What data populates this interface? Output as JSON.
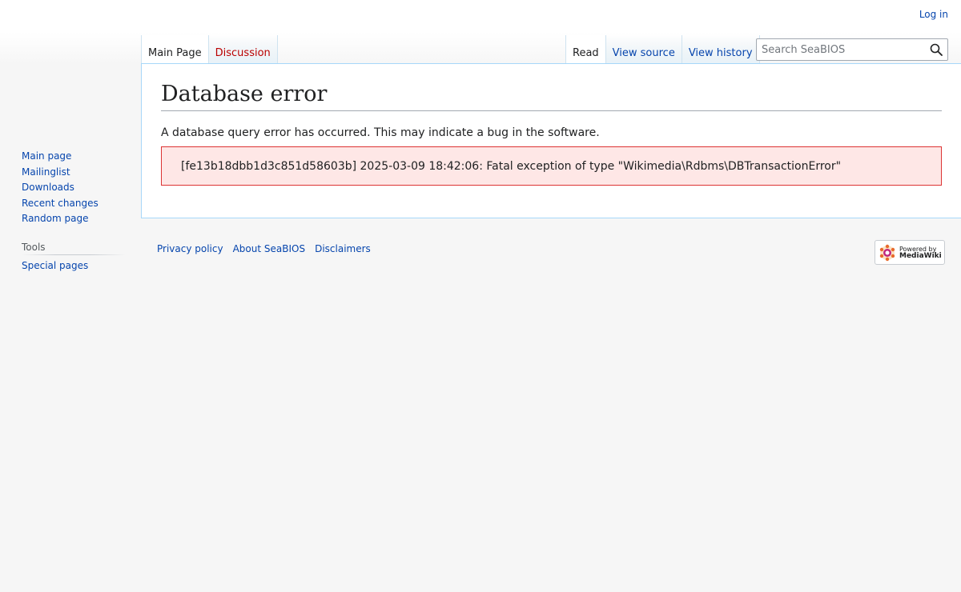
{
  "personal": {
    "login": "Log in"
  },
  "tabs": {
    "left": [
      "Main Page",
      "Discussion"
    ],
    "right": [
      "Read",
      "View source",
      "View history"
    ]
  },
  "search": {
    "placeholder": "Search SeaBIOS"
  },
  "content": {
    "title": "Database error",
    "intro": "A database query error has occurred. This may indicate a bug in the software.",
    "error": "[fe13b18dbb1d3c851d58603b] 2025-03-09 18:42:06: Fatal exception of type \"Wikimedia\\Rdbms\\DBTransactionError\""
  },
  "sidebar": {
    "navigation": [
      "Main page",
      "Mailinglist",
      "Downloads",
      "Recent changes",
      "Random page"
    ],
    "tools_heading": "Tools",
    "tools": [
      "Special pages"
    ]
  },
  "footer": {
    "links": [
      "Privacy policy",
      "About SeaBIOS",
      "Disclaimers"
    ],
    "powered_small": "Powered by",
    "powered_big": "MediaWiki"
  },
  "colors": {
    "link": "#0645ad",
    "new_link": "#ba0000",
    "error_bg": "#fee7e6",
    "error_border": "#dd3333"
  }
}
